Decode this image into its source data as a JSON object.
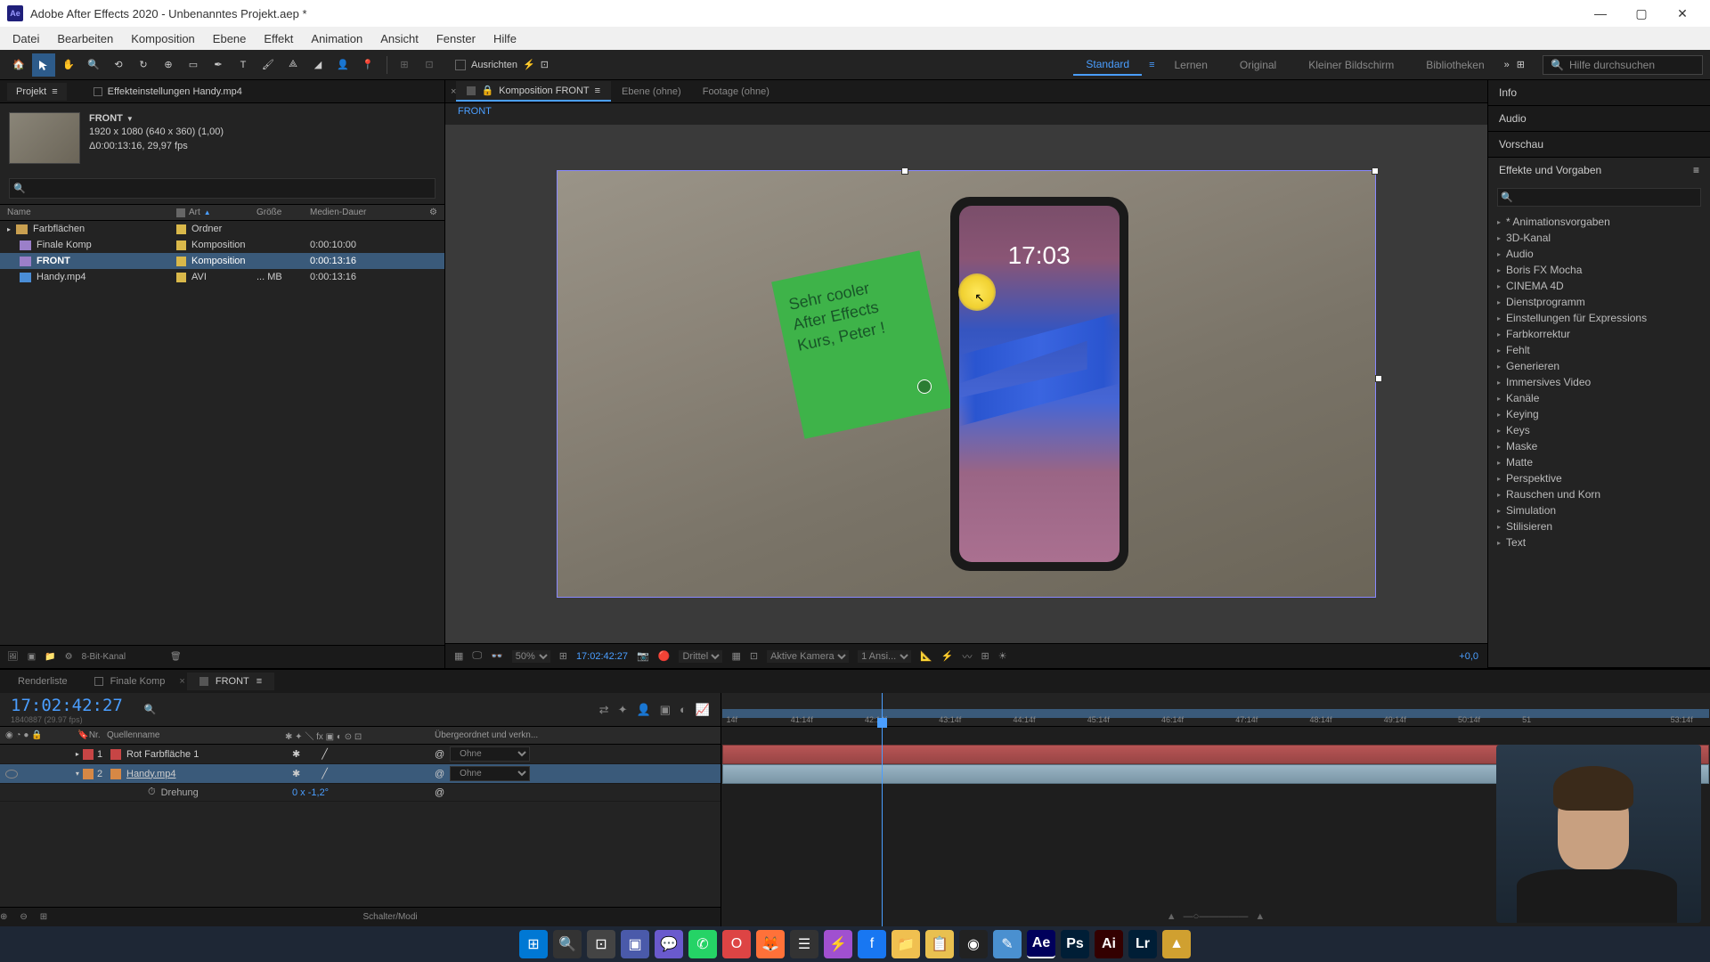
{
  "titlebar": {
    "app_icon_text": "Ae",
    "title": "Adobe After Effects 2020 - Unbenanntes Projekt.aep *"
  },
  "menu": {
    "items": [
      "Datei",
      "Bearbeiten",
      "Komposition",
      "Ebene",
      "Effekt",
      "Animation",
      "Ansicht",
      "Fenster",
      "Hilfe"
    ]
  },
  "toolbar": {
    "align_label": "Ausrichten",
    "workspaces": [
      "Standard",
      "Lernen",
      "Original",
      "Kleiner Bildschirm",
      "Bibliotheken"
    ],
    "active_workspace": "Standard",
    "search_placeholder": "Hilfe durchsuchen"
  },
  "project": {
    "panel_title": "Projekt",
    "effect_settings_label": "Effekteinstellungen Handy.mp4",
    "comp_name": "FRONT",
    "meta_line1": "1920 x 1080 (640 x 360) (1,00)",
    "meta_line2": "Δ0:00:13:16, 29,97 fps",
    "columns": {
      "name": "Name",
      "type": "Art",
      "size": "Größe",
      "duration": "Medien-Dauer"
    },
    "items": [
      {
        "name": "Farbflächen",
        "type": "Ordner",
        "size": "",
        "duration": "",
        "icon": "folder"
      },
      {
        "name": "Finale Komp",
        "type": "Komposition",
        "size": "",
        "duration": "0:00:10:00",
        "icon": "comp"
      },
      {
        "name": "FRONT",
        "type": "Komposition",
        "size": "",
        "duration": "0:00:13:16",
        "icon": "comp",
        "selected": true
      },
      {
        "name": "Handy.mp4",
        "type": "AVI",
        "size": "... MB",
        "duration": "0:00:13:16",
        "icon": "video"
      }
    ],
    "footer_bpc": "8-Bit-Kanal"
  },
  "viewer": {
    "tabs": [
      {
        "label": "Komposition FRONT",
        "active": true
      },
      {
        "label": "Ebene (ohne)",
        "active": false
      },
      {
        "label": "Footage (ohne)",
        "active": false
      }
    ],
    "breadcrumb": "FRONT",
    "note_line1": "Sehr cooler",
    "note_line2": "After Effects",
    "note_line3": "Kurs, Peter !",
    "phone_time": "17:03",
    "footer": {
      "zoom": "50%",
      "timecode": "17:02:42:27",
      "quality": "Drittel",
      "camera": "Aktive Kamera",
      "views": "1 Ansi...",
      "exposure": "+0,0"
    }
  },
  "right": {
    "panels": [
      "Info",
      "Audio",
      "Vorschau",
      "Effekte und Vorgaben"
    ],
    "effects": [
      "* Animationsvorgaben",
      "3D-Kanal",
      "Audio",
      "Boris FX Mocha",
      "CINEMA 4D",
      "Dienstprogramm",
      "Einstellungen für Expressions",
      "Farbkorrektur",
      "Fehlt",
      "Generieren",
      "Immersives Video",
      "Kanäle",
      "Keying",
      "Keys",
      "Maske",
      "Matte",
      "Perspektive",
      "Rauschen und Korn",
      "Simulation",
      "Stilisieren",
      "Text"
    ]
  },
  "timeline": {
    "tabs": [
      {
        "label": "Renderliste",
        "active": false
      },
      {
        "label": "Finale Komp",
        "active": false
      },
      {
        "label": "FRONT",
        "active": true
      }
    ],
    "timecode": "17:02:42:27",
    "frames_sub": "1840887 (29.97 fps)",
    "columns": {
      "num": "Nr.",
      "name": "Quellenname",
      "parent": "Übergeordnet und verkn..."
    },
    "layers": [
      {
        "num": "1",
        "name": "Rot Farbfläche 1",
        "color": "red",
        "parent": "Ohne",
        "visible": false
      },
      {
        "num": "2",
        "name": "Handy.mp4",
        "color": "orange",
        "parent": "Ohne",
        "visible": true,
        "selected": true
      }
    ],
    "property": {
      "name": "Drehung",
      "value": "0 x -1,2°"
    },
    "ruler_ticks": [
      "14f",
      "41:14f",
      "42:14f",
      "43:14f",
      "44:14f",
      "45:14f",
      "46:14f",
      "47:14f",
      "48:14f",
      "49:14f",
      "50:14f",
      "51",
      "53:14f"
    ],
    "footer_label": "Schalter/Modi"
  }
}
